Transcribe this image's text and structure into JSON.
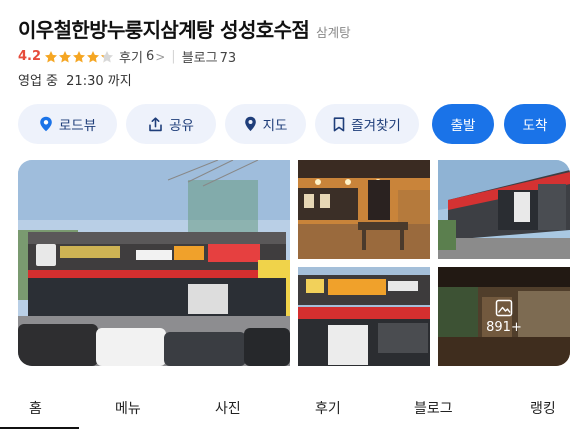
{
  "place": {
    "name": "이우철한방누룽지삼계탕 성성호수점",
    "category": "삼계탕"
  },
  "rating": {
    "score": "4.2",
    "stars_filled": 4.2,
    "stars_total": 5,
    "star_color": "#f5a623",
    "reviews_label": "후기",
    "reviews_count": "6",
    "chevron": ">",
    "blog_label": "블로그",
    "blog_count": "73"
  },
  "hours": {
    "status": "영업 중",
    "until": "21:30 까지"
  },
  "actions": [
    {
      "label": "로드뷰",
      "icon": "pin-icon"
    },
    {
      "label": "공유",
      "icon": "share-icon"
    },
    {
      "label": "지도",
      "icon": "map-pin-icon"
    },
    {
      "label": "즐겨찾기",
      "icon": "bookmark-icon"
    },
    {
      "label": "출발",
      "icon": ""
    },
    {
      "label": "도착",
      "icon": ""
    }
  ],
  "colors": {
    "primary": "#1a73e8",
    "chip_bg": "#eef2fb",
    "rating_red": "#e64b3b"
  },
  "gallery": {
    "more_count": "891+",
    "more_icon": "image-icon"
  },
  "tabs": [
    {
      "label": "홈",
      "active": true
    },
    {
      "label": "메뉴",
      "active": false
    },
    {
      "label": "사진",
      "active": false
    },
    {
      "label": "후기",
      "active": false
    },
    {
      "label": "블로그",
      "active": false
    },
    {
      "label": "랭킹",
      "active": false
    }
  ]
}
